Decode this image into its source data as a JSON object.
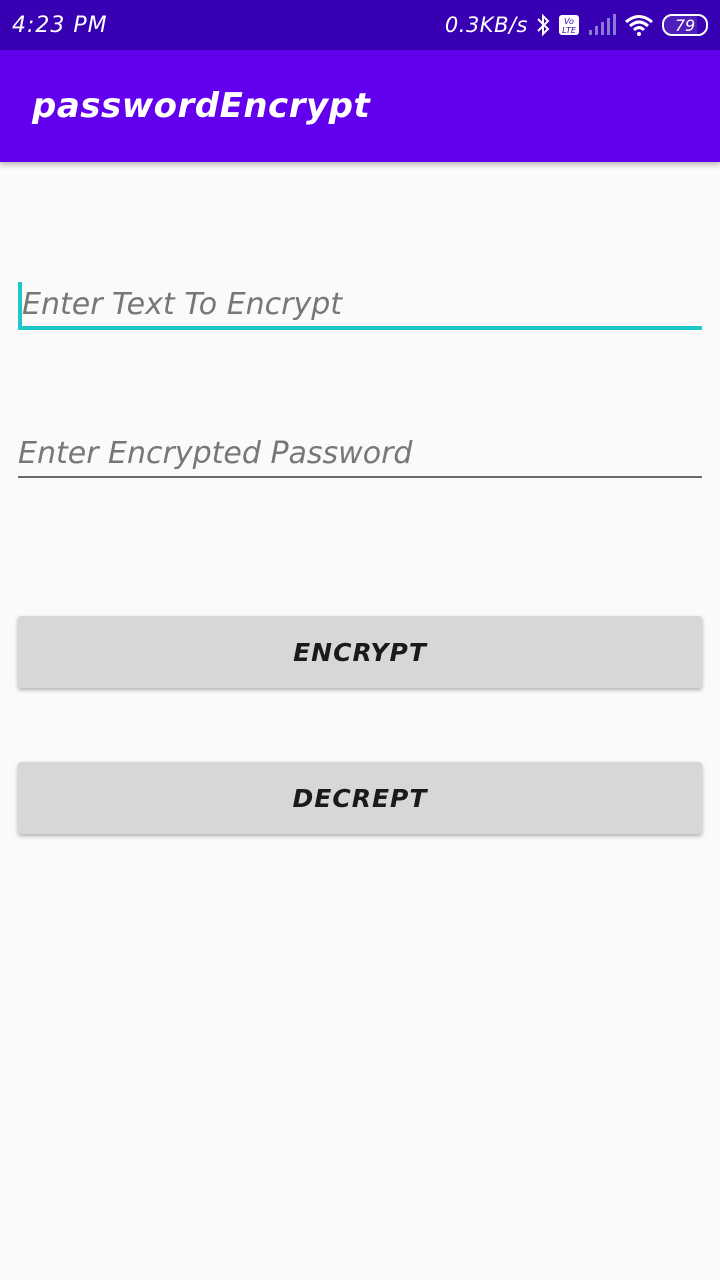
{
  "status_bar": {
    "time": "4:23 PM",
    "net_speed": "0.3KB/s",
    "battery": "79",
    "icons": [
      "bluetooth-icon",
      "volte-icon",
      "signal-icon",
      "wifi-icon",
      "battery-icon"
    ]
  },
  "app_bar": {
    "title": "passwordEncrypt",
    "color": "#6200ee"
  },
  "form": {
    "text_placeholder": "Enter Text To Encrypt",
    "text_value": "",
    "password_placeholder": "Enter Encrypted Password",
    "password_value": ""
  },
  "buttons": {
    "encrypt_label": "ENCRYPT",
    "decrypt_label": "DECREPT"
  },
  "colors": {
    "status_bar": "#3700b3",
    "accent": "#1ec8c8",
    "button_bg": "#d6d7d7"
  }
}
